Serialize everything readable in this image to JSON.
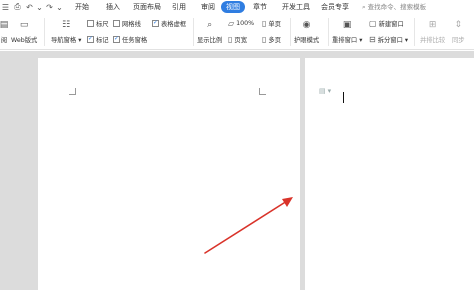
{
  "menu": {
    "tabs": [
      "开始",
      "插入",
      "页面布局",
      "引用",
      "审阅",
      "视图",
      "章节",
      "开发工具",
      "会员专享"
    ],
    "active_tab": "视图",
    "search_placeholder": "查找命令、搜索模板",
    "accent_color": "#2f7de1"
  },
  "ribbon": {
    "read_mode": "阅",
    "web_layout": "Web版式",
    "nav_pane": "导航窗格",
    "ruler": "标尺",
    "gridlines": "网格线",
    "table_gridlines": "表格虚框",
    "markup": "标记",
    "task_pane": "任务窗格",
    "zoom_ratio": "显示比例",
    "zoom_percent": "100%",
    "page_width": "页宽",
    "single_page": "单页",
    "multi_page": "多页",
    "eye_protection": "护眼模式",
    "rearrange_windows": "重排窗口",
    "new_window": "新建窗口",
    "split_window": "拆分窗口",
    "side_by_side": "并排比较",
    "sync_scroll": "同步"
  },
  "checkboxes": {
    "ruler": false,
    "gridlines": false,
    "table_gridlines": true,
    "markup": true,
    "task_pane": true
  },
  "annotation": {
    "arrow_color": "#d9332a"
  }
}
